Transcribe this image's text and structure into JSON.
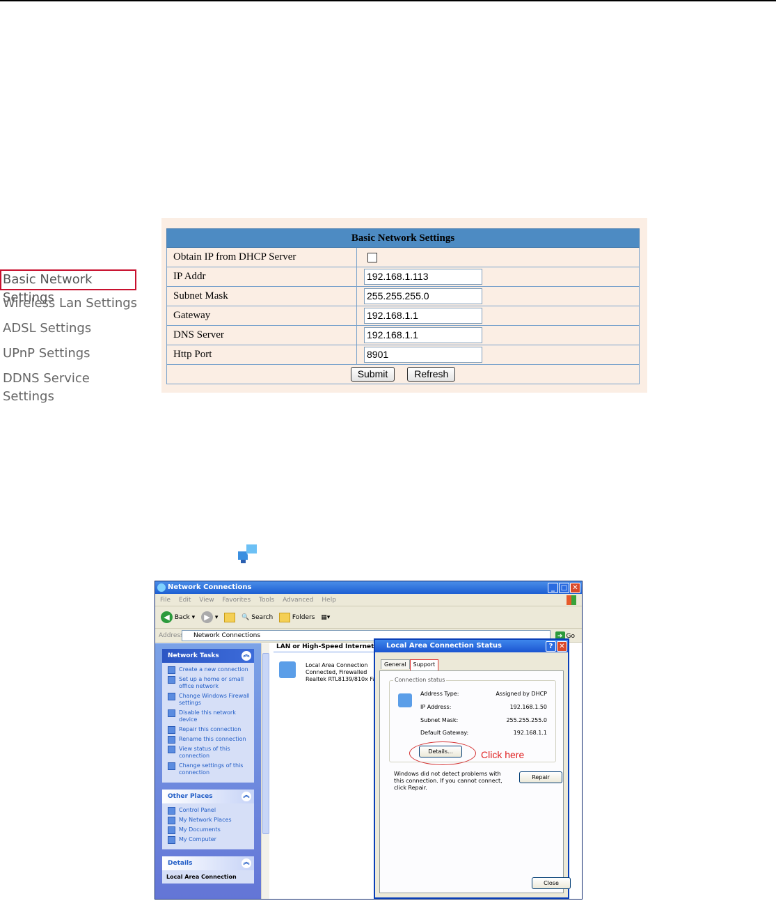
{
  "left_nav": {
    "items": [
      {
        "label": "Basic Network Settings"
      },
      {
        "label": "Wireless Lan Settings"
      },
      {
        "label": "ADSL Settings"
      },
      {
        "label": "UPnP Settings"
      },
      {
        "label": "DDNS Service Settings"
      }
    ]
  },
  "settings": {
    "title": "Basic Network Settings",
    "dhcp_label": "Obtain IP from DHCP Server",
    "dhcp_checked": false,
    "fields": [
      {
        "label": "IP Addr",
        "value": "192.168.1.113"
      },
      {
        "label": "Subnet Mask",
        "value": "255.255.255.0"
      },
      {
        "label": "Gateway",
        "value": "192.168.1.1"
      },
      {
        "label": "DNS Server",
        "value": "192.168.1.1"
      },
      {
        "label": "Http Port",
        "value": "8901"
      }
    ],
    "submit_label": "Submit",
    "refresh_label": "Refresh"
  },
  "explorer": {
    "title": "Network Connections",
    "menu": [
      "File",
      "Edit",
      "View",
      "Favorites",
      "Tools",
      "Advanced",
      "Help"
    ],
    "toolbar": {
      "back": "Back",
      "search": "Search",
      "folders": "Folders"
    },
    "address_label": "Address",
    "address_value": "Network Connections",
    "go_label": "Go",
    "network_tasks": {
      "heading": "Network Tasks",
      "links": [
        "Create a new connection",
        "Set up a home or small office network",
        "Change Windows Firewall settings",
        "Disable this network device",
        "Repair this connection",
        "Rename this connection",
        "View status of this connection",
        "Change settings of this connection"
      ]
    },
    "other_places": {
      "heading": "Other Places",
      "links": [
        "Control Panel",
        "My Network Places",
        "My Documents",
        "My Computer"
      ]
    },
    "details": {
      "heading": "Details",
      "item": "Local Area Connection"
    },
    "group_heading": "LAN or High-Speed Internet",
    "connection": {
      "line1": "Local Area Connection",
      "line2": "Connected, Firewalled",
      "line3": "Realtek RTL8139/810x Fa"
    }
  },
  "dialog": {
    "title": "Local Area Connection Status",
    "tabs": [
      "General",
      "Support"
    ],
    "group_label": "Connection status",
    "rows": [
      {
        "key": "Address Type:",
        "value": "Assigned by DHCP"
      },
      {
        "key": "IP Address:",
        "value": "192.168.1.50"
      },
      {
        "key": "Subnet Mask:",
        "value": "255.255.255.0"
      },
      {
        "key": "Default Gateway:",
        "value": "192.168.1.1"
      }
    ],
    "details_label": "Details...",
    "click_here": "Click here",
    "warning": "Windows did not detect problems with this connection. If you cannot connect, click Repair.",
    "repair_label": "Repair",
    "close_label": "Close"
  }
}
